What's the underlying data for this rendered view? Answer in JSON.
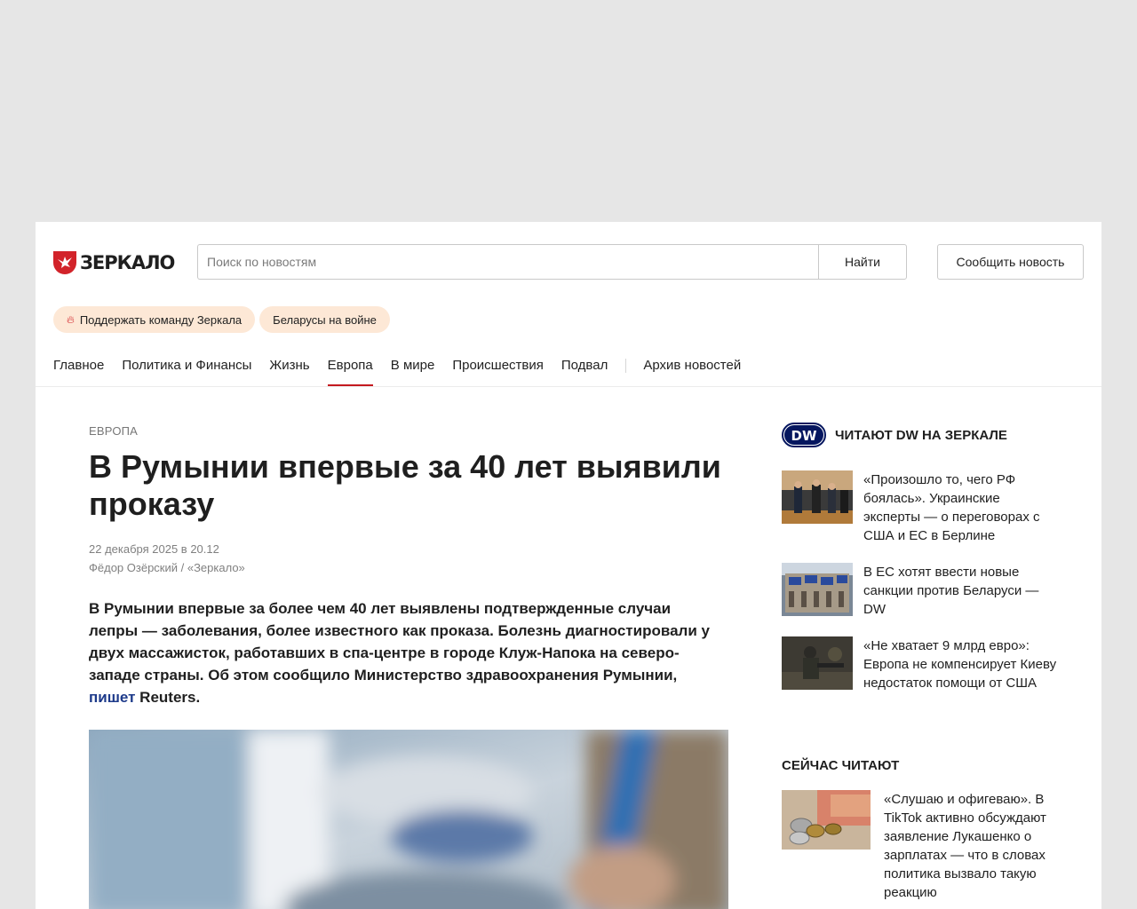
{
  "header": {
    "logo_text": "ЗЕРКАЛО",
    "search_placeholder": "Поиск по новостям",
    "search_button": "Найти",
    "report_button": "Сообщить новость"
  },
  "pills": [
    {
      "label": "Поддержать команду Зеркала",
      "icon": "flame-icon"
    },
    {
      "label": "Беларусы на войне"
    }
  ],
  "nav": {
    "items": [
      "Главное",
      "Политика и Финансы",
      "Жизнь",
      "Европа",
      "В мире",
      "Происшествия",
      "Подвал"
    ],
    "active": "Европа",
    "archive": "Архив новостей"
  },
  "article": {
    "rubric": "Европа",
    "title": "В Румынии впервые за 40 лет выявили проказу",
    "date": "22 декабря 2025 в 20.12",
    "author": "Фёдор Озёрский / «Зеркало»",
    "lead_text": "В Румынии впервые за более чем 40 лет выявлены подтвержденные случаи лепры — заболевания, более известного как проказа. Болезнь диагностировали у двух массажисток, работавших в спа-центре в городе Клуж-Напока на северо-западе страны. Об этом сообщило Министерство здравоохранения Румынии,",
    "lead_link": "пишет",
    "lead_tail": " Reuters."
  },
  "sidebar": {
    "dw_logo": "DW",
    "dw_title": "Читают DW на Зеркале",
    "dw_items": [
      "«Произошло то, чего РФ боялась». Украинские эксперты — о переговорах с США и ЕС в Берлине",
      "В ЕС хотят ввести новые санкции против Беларуси — DW",
      "«Не хватает 9 млрд евро»: Европа не компенсирует Киеву недостаток помощи от США"
    ],
    "now_title": "Сейчас читают",
    "now_items": [
      "«Слушаю и офигеваю». В TikTok активно обсуждают заявление Лукашенко о зарплатах — что в словах политика вызвало такую реакцию"
    ]
  },
  "colors": {
    "brand": "#d2232a",
    "link": "#1d3a8a",
    "pill_bg": "#fde8d6",
    "page_bg": "#e6e6e6"
  }
}
